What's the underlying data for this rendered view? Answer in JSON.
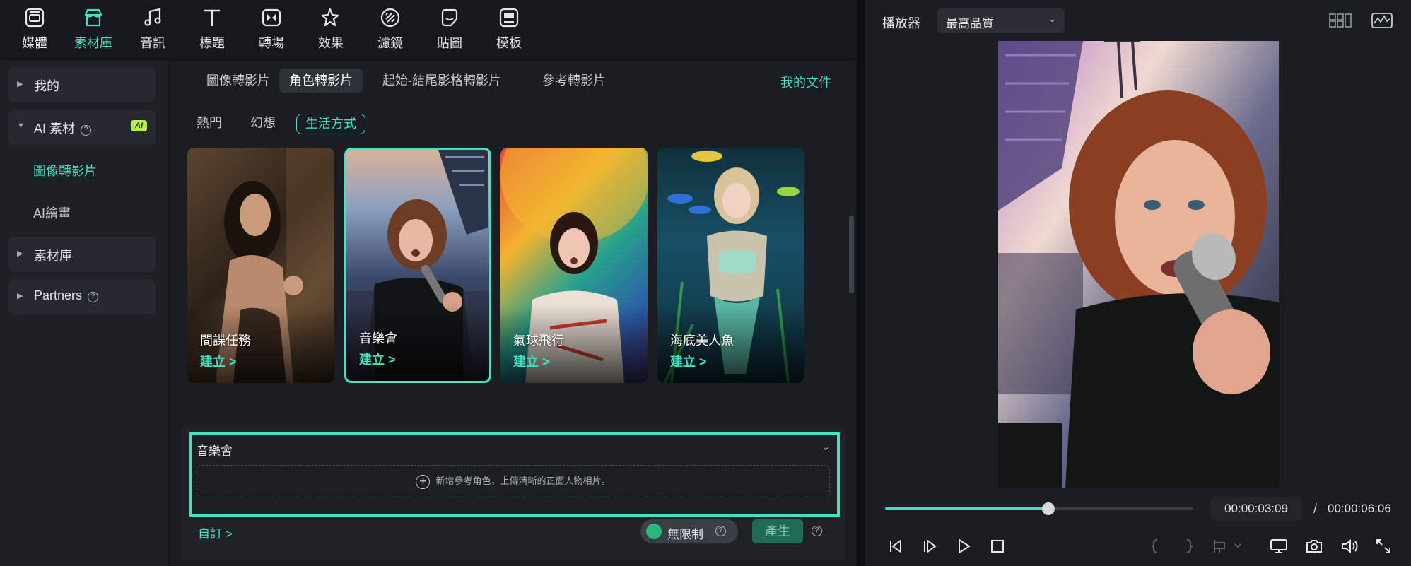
{
  "toolbar": {
    "items": [
      {
        "label": "媒體",
        "icon": "media-icon"
      },
      {
        "label": "素材庫",
        "icon": "stock-library-icon"
      },
      {
        "label": "音訊",
        "icon": "music-note-icon"
      },
      {
        "label": "標題",
        "icon": "title-t-icon"
      },
      {
        "label": "轉場",
        "icon": "transition-icon"
      },
      {
        "label": "效果",
        "icon": "effects-star-icon"
      },
      {
        "label": "濾鏡",
        "icon": "filter-icon"
      },
      {
        "label": "貼圖",
        "icon": "sticker-icon"
      },
      {
        "label": "模板",
        "icon": "template-icon"
      }
    ],
    "active_index": 1
  },
  "sidebar": {
    "mine": "我的",
    "ai_material": "AI 素材",
    "ai_badge": "AI",
    "sub_image_to_video": "圖像轉影片",
    "sub_ai_painting": "AI繪畫",
    "stock_library": "素材庫",
    "partners": "Partners"
  },
  "tabs": {
    "items": [
      "圖像轉影片",
      "角色轉影片",
      "起始-結尾影格轉影片",
      "參考轉影片"
    ],
    "active": "角色轉影片",
    "my_files": "我的文件"
  },
  "chips": {
    "items": [
      "熱門",
      "幻想",
      "生活方式"
    ],
    "active": "生活方式"
  },
  "cards": [
    {
      "title": "間諜任務",
      "action": "建立 >"
    },
    {
      "title": "音樂會",
      "action": "建立 >"
    },
    {
      "title": "氣球飛行",
      "action": "建立 >"
    },
    {
      "title": "海底美人魚",
      "action": "建立 >"
    }
  ],
  "prompt": {
    "title": "音樂會",
    "add_reference": "新增參考角色，上傳清晰的正面人物相片。",
    "custom": "自訂 >",
    "unlimited": "無限制",
    "generate": "產生"
  },
  "player": {
    "title": "播放器",
    "quality": "最高品質",
    "current_time": "00:00:03:09",
    "separator": "/",
    "total_time": "00:00:06:06",
    "progress": 0.53
  },
  "colors": {
    "accent": "#45e0c0",
    "ai_badge": "#b6f04a",
    "panel": "#1a1d22"
  }
}
